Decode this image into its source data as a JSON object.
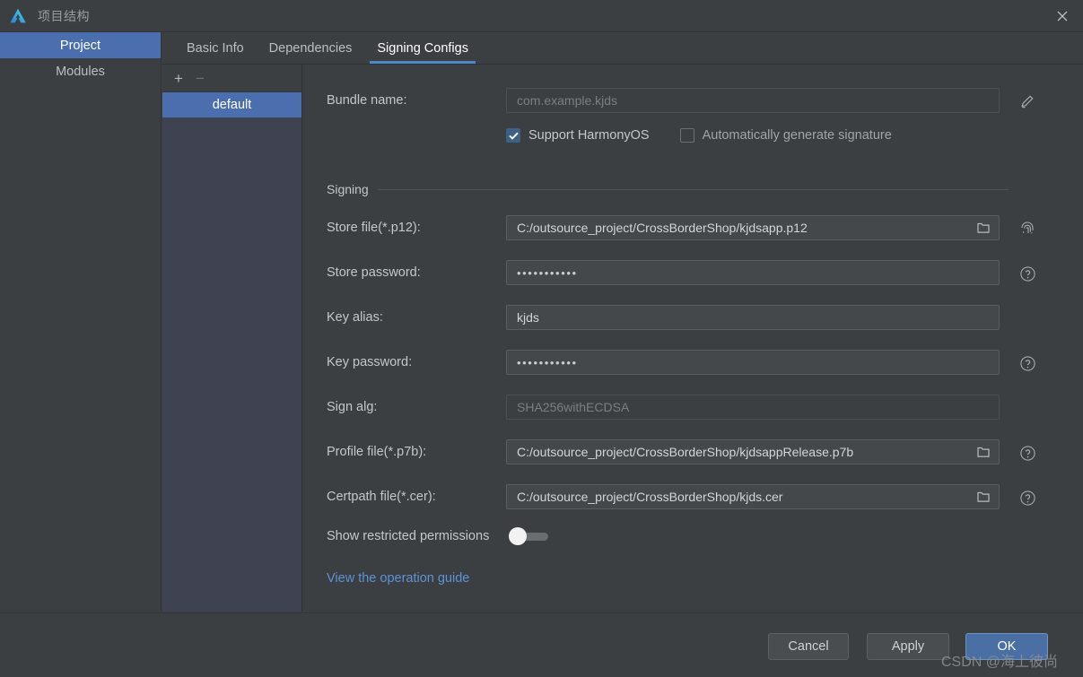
{
  "titlebar": {
    "title": "项目结构",
    "logo_icon": "deveco-logo-icon",
    "close_icon": "close-icon"
  },
  "sidebar": {
    "items": [
      {
        "label": "Project",
        "active": true
      },
      {
        "label": "Modules",
        "active": false
      }
    ]
  },
  "tabs": [
    {
      "label": "Basic Info",
      "active": false
    },
    {
      "label": "Dependencies",
      "active": false
    },
    {
      "label": "Signing Configs",
      "active": true
    }
  ],
  "config_list": {
    "add_icon": "plus-icon",
    "remove_icon": "minus-icon",
    "items": [
      {
        "label": "default",
        "selected": true
      }
    ]
  },
  "form": {
    "bundle_name": {
      "label": "Bundle name:",
      "value": "com.example.kjds",
      "disabled": true,
      "edit_icon": "pencil-icon"
    },
    "checkboxes": [
      {
        "label": "Support HarmonyOS",
        "checked": true
      },
      {
        "label": "Automatically generate signature",
        "checked": false
      }
    ],
    "signing_group_title": "Signing",
    "fields": [
      {
        "label": "Store file(*.p12):",
        "value": "C:/outsource_project/CrossBorderShop/kjdsapp.p12",
        "type": "file",
        "browse_icon": "folder-icon",
        "side_icon": "fingerprint-icon"
      },
      {
        "label": "Store password:",
        "value": "•••••••••••",
        "type": "password",
        "side_icon": "help-icon"
      },
      {
        "label": "Key alias:",
        "value": "kjds",
        "type": "text",
        "side_icon": ""
      },
      {
        "label": "Key password:",
        "value": "•••••••••••",
        "type": "password",
        "side_icon": "help-icon"
      },
      {
        "label": "Sign alg:",
        "value": "SHA256withECDSA",
        "type": "text",
        "disabled": true,
        "side_icon": ""
      },
      {
        "label": "Profile file(*.p7b):",
        "value": "C:/outsource_project/CrossBorderShop/kjdsappRelease.p7b",
        "type": "file",
        "browse_icon": "folder-icon",
        "side_icon": "help-icon"
      },
      {
        "label": "Certpath file(*.cer):",
        "value": "C:/outsource_project/CrossBorderShop/kjds.cer",
        "type": "file",
        "browse_icon": "folder-icon",
        "side_icon": "help-icon"
      }
    ],
    "toggle": {
      "label": "Show restricted permissions",
      "on": false
    },
    "guide_link": "View the operation guide"
  },
  "footer": {
    "cancel": "Cancel",
    "apply": "Apply",
    "ok": "OK"
  },
  "watermark": "CSDN @海上彼尚",
  "colors": {
    "accent_blue": "#4b6eaf",
    "tab_underline": "#4a88c7",
    "link_blue": "#5c92d6",
    "checkbox_blue": "#3d6185",
    "window_bg": "#3c3f41",
    "field_bg": "#45484a"
  }
}
